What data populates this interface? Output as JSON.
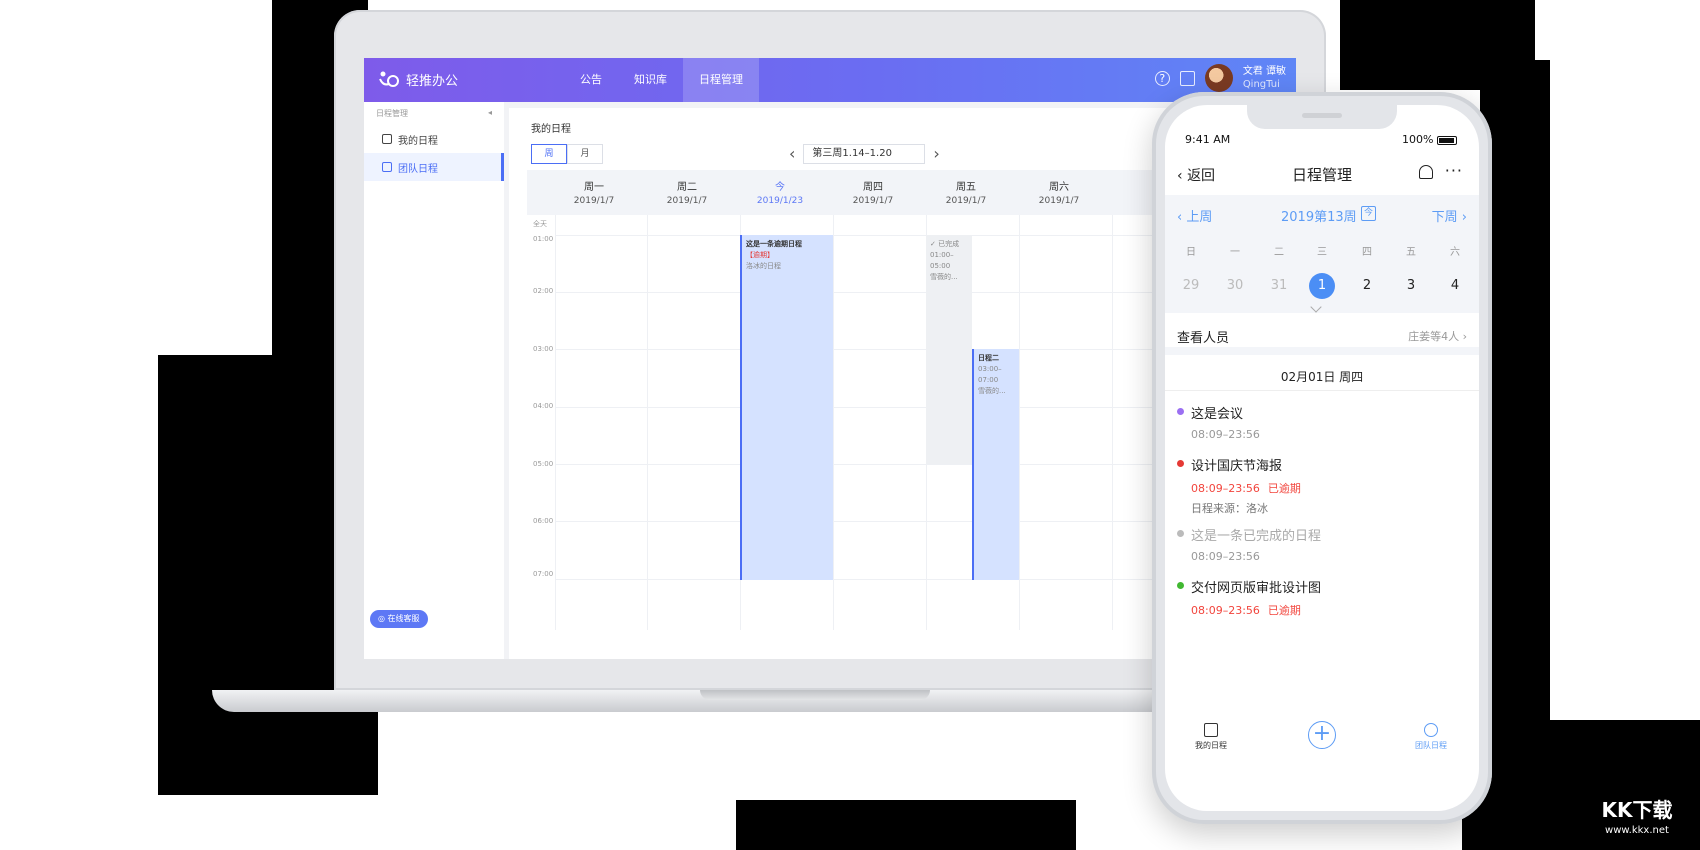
{
  "desktop": {
    "app_name": "轻推办公",
    "nav": [
      "公告",
      "知识库",
      "日程管理"
    ],
    "user": {
      "name": "文君 谭敏",
      "org": "QingTui"
    },
    "sidebar": {
      "section": "日程管理",
      "items": [
        "我的日程",
        "团队日程"
      ],
      "service": "在线客服"
    },
    "main": {
      "title": "我的日程",
      "view_week": "周",
      "view_month": "月",
      "week_range": "第三周1.14–1.20",
      "days": [
        {
          "name": "周一",
          "date": "2019/1/7"
        },
        {
          "name": "周二",
          "date": "2019/1/7"
        },
        {
          "name": "今",
          "date": "2019/1/23"
        },
        {
          "name": "周四",
          "date": "2019/1/7"
        },
        {
          "name": "周五",
          "date": "2019/1/7"
        },
        {
          "name": "周六",
          "date": "2019/1/7"
        }
      ],
      "allday": "全天",
      "hours": [
        "01:00",
        "02:00",
        "03:00",
        "04:00",
        "05:00",
        "06:00",
        "07:00"
      ],
      "events": [
        {
          "title": "这是一条逾期日程",
          "flag": "【逾期】",
          "owner": "洛冰的日程"
        },
        {
          "status": "已完成",
          "time": "01:00–05:00",
          "owner": "雪薇的..."
        },
        {
          "title": "日程二",
          "time": "03:00–07:00",
          "owner": "雪薇的..."
        }
      ]
    }
  },
  "mobile": {
    "time": "9:41 AM",
    "battery": "100%",
    "back": "返回",
    "title": "日程管理",
    "prev_week": "上周",
    "current_week": "2019第13周",
    "today": "今",
    "next_week": "下周",
    "weekdays": [
      "日",
      "一",
      "二",
      "三",
      "四",
      "五",
      "六"
    ],
    "days": [
      "29",
      "30",
      "31",
      "1",
      "2",
      "3",
      "4"
    ],
    "viewers_label": "查看人员",
    "viewers_value": "庄姜等4人",
    "date_heading": "02月01日 周四",
    "items": [
      {
        "title": "这是会议",
        "time": "08:09–23:56",
        "dot": "#9b6ff2"
      },
      {
        "title": "设计国庆节海报",
        "time": "08:09–23:56",
        "status": "已逾期",
        "source": "日程来源：洛冰",
        "dot": "#e53935"
      },
      {
        "title": "这是一条已完成的日程",
        "time": "08:09–23:56",
        "dot": "#bbbbbb"
      },
      {
        "title": "交付网页版审批设计图",
        "time": "08:09–23:56",
        "status": "已逾期",
        "dot": "#41b832"
      }
    ],
    "tabs": [
      "我的日程",
      "团队日程"
    ]
  },
  "watermark": {
    "brand": "KK下载",
    "url": "www.kkx.net"
  },
  "colors": {
    "accent": "#5d78f5",
    "late": "#f2453d",
    "event_bg": "#d5e2ff"
  }
}
